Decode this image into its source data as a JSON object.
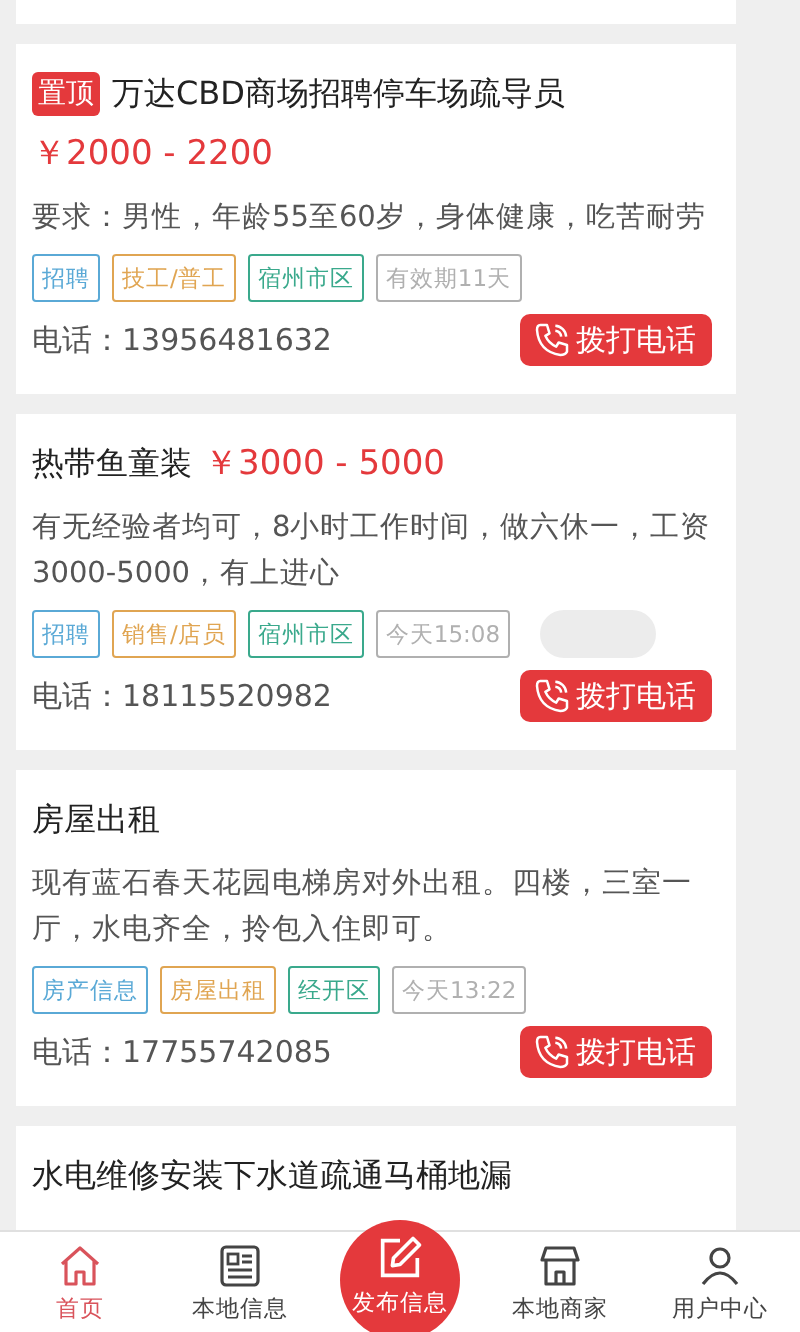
{
  "listings": [
    {
      "pinned": true,
      "pin_label": "置顶",
      "title": "万达CBD商场招聘停车场疏导员",
      "price": "￥2000 - 2200",
      "description": "要求：男性，年龄55至60岁，身体健康，吃苦耐劳",
      "tags": [
        {
          "label": "招聘",
          "color": "#5aa9d6"
        },
        {
          "label": "技工/普工",
          "color": "#e0a552"
        },
        {
          "label": "宿州市区",
          "color": "#3aa98c"
        },
        {
          "label": "有效期11天",
          "color": "#b0b0b0"
        }
      ],
      "phone": "电话：13956481632",
      "call_label": "拨打电话"
    },
    {
      "pinned": false,
      "title": "热带鱼童装",
      "price": "￥3000 - 5000",
      "description": "有无经验者均可，8小时工作时间，做六休一，工资3000-5000，有上进心",
      "tags": [
        {
          "label": "招聘",
          "color": "#5aa9d6"
        },
        {
          "label": "销售/店员",
          "color": "#e0a552"
        },
        {
          "label": "宿州市区",
          "color": "#3aa98c"
        },
        {
          "label": "今天15:08",
          "color": "#b0b0b0"
        }
      ],
      "phone": "电话：18115520982",
      "call_label": "拨打电话"
    },
    {
      "pinned": false,
      "title": "房屋出租",
      "description": "现有蓝石春天花园电梯房对外出租。四楼，三室一厅，水电齐全，拎包入住即可。",
      "tags": [
        {
          "label": "房产信息",
          "color": "#5aa9d6"
        },
        {
          "label": "房屋出租",
          "color": "#e0a552"
        },
        {
          "label": "经开区",
          "color": "#3aa98c"
        },
        {
          "label": "今天13:22",
          "color": "#b0b0b0"
        }
      ],
      "phone": "电话：17755742085",
      "call_label": "拨打电话"
    },
    {
      "pinned": false,
      "title": "水电维修安装下水道疏通马桶地漏"
    }
  ],
  "tab_bar": [
    {
      "kind": "home",
      "label": "首页",
      "selected": true
    },
    {
      "kind": "news",
      "label": "本地信息",
      "selected": false
    },
    {
      "kind": "publish",
      "label": "发布信息",
      "selected": false
    },
    {
      "kind": "shop",
      "label": "本地商家",
      "selected": false
    },
    {
      "kind": "user",
      "label": "用户中心",
      "selected": false
    }
  ]
}
